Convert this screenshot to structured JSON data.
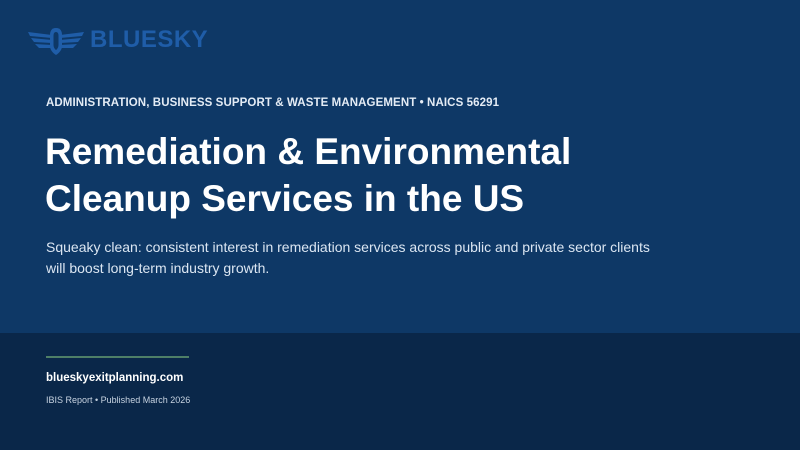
{
  "brand": {
    "name": "BLUESKY",
    "icon": "eagle-wings-logo-icon"
  },
  "report": {
    "category": "ADMINISTRATION, BUSINESS SUPPORT & WASTE MANAGEMENT • NAICS 56291",
    "title_line1": "Remediation & Environmental",
    "title_line2": "Cleanup Services in the US",
    "subtitle": "Squeaky clean: consistent interest in remediation services across public and private sector clients will boost long-term industry growth."
  },
  "footer": {
    "website": "blueskyexitplanning.com",
    "meta": "IBIS Report • Published March 2026"
  },
  "colors": {
    "top_background": "#0e3866",
    "bottom_background": "#0a2749",
    "logo": "#1f5da8",
    "divider_accent": "#4e7f67"
  }
}
